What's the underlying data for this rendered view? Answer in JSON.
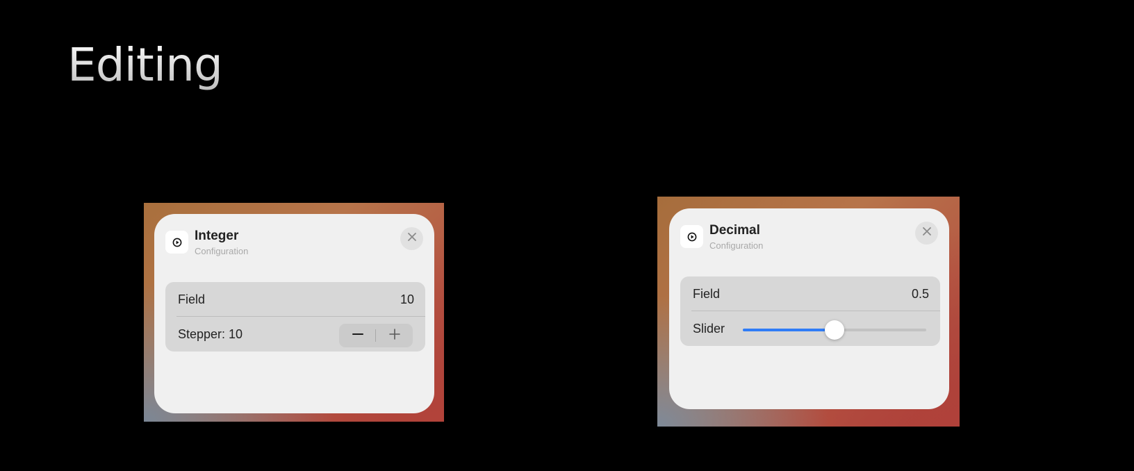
{
  "slide": {
    "title": "Editing"
  },
  "integer_panel": {
    "title": "Integer",
    "subtitle": "Configuration",
    "icon": "play-circle-icon",
    "rows": {
      "field": {
        "label": "Field",
        "value": "10"
      },
      "stepper": {
        "label": "Stepper: 10",
        "value": 10,
        "minus_icon": "minus-icon",
        "plus_icon": "plus-icon"
      }
    }
  },
  "decimal_panel": {
    "title": "Decimal",
    "subtitle": "Configuration",
    "icon": "play-circle-icon",
    "rows": {
      "field": {
        "label": "Field",
        "value": "0.5"
      },
      "slider": {
        "label": "Slider",
        "value": 0.5,
        "min": 0,
        "max": 1
      }
    }
  },
  "colors": {
    "accent": "#2f7cf6",
    "sheet_background": "#f0f0f0",
    "group_background": "#d7d7d7"
  }
}
